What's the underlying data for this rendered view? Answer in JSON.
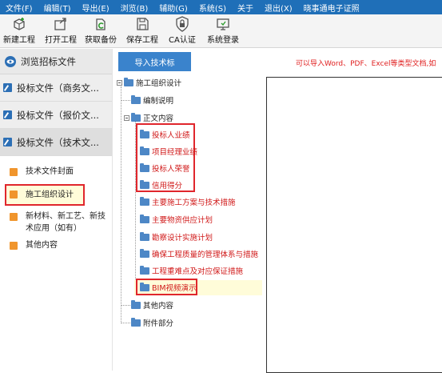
{
  "menu": [
    "文件(F)",
    "编辑(T)",
    "导出(E)",
    "浏览(B)",
    "辅助(G)",
    "系统(S)",
    "关于",
    "退出(X)",
    "晓事通电子证照"
  ],
  "toolbar": {
    "new": "新建工程",
    "open": "打开工程",
    "backup": "获取备份",
    "save": "保存工程",
    "ca": "CA认证",
    "login": "系统登录"
  },
  "leftnav": {
    "browse": "浏览招标文件",
    "sec1": "投标文件（商务文...",
    "sec2": "投标文件（报价文...",
    "sec3": "投标文件（技术文...",
    "items": [
      "技术文件封面",
      "施工组织设计",
      "新材料、新工艺、新技术应用（如有）",
      "其他内容"
    ]
  },
  "main": {
    "import_label": "导入技术标",
    "hint": "可以导入Word、PDF、Excel等类型文档,如"
  },
  "tree": {
    "root": "施工组织设计",
    "n1": "编制说明",
    "n2": "正文内容",
    "c1": "投标人业绩",
    "c2": "项目经理业绩",
    "c3": "投标人荣誉",
    "c4": "信用得分",
    "c5": "主要施工方案与技术措施",
    "c6": "主要物资供应计划",
    "c7": "勘察设计实施计划",
    "c8": "确保工程质量的管理体系与措施",
    "c9": "工程重难点及对应保证措施",
    "c10": "BIM视频演示",
    "n3": "其他内容",
    "n4": "附件部分"
  },
  "colors": {
    "menubar": "#1f6fb8",
    "accent": "#3a83cc",
    "red": "#e0262c",
    "folder": "#4d87c6",
    "orange": "#f0952c"
  }
}
